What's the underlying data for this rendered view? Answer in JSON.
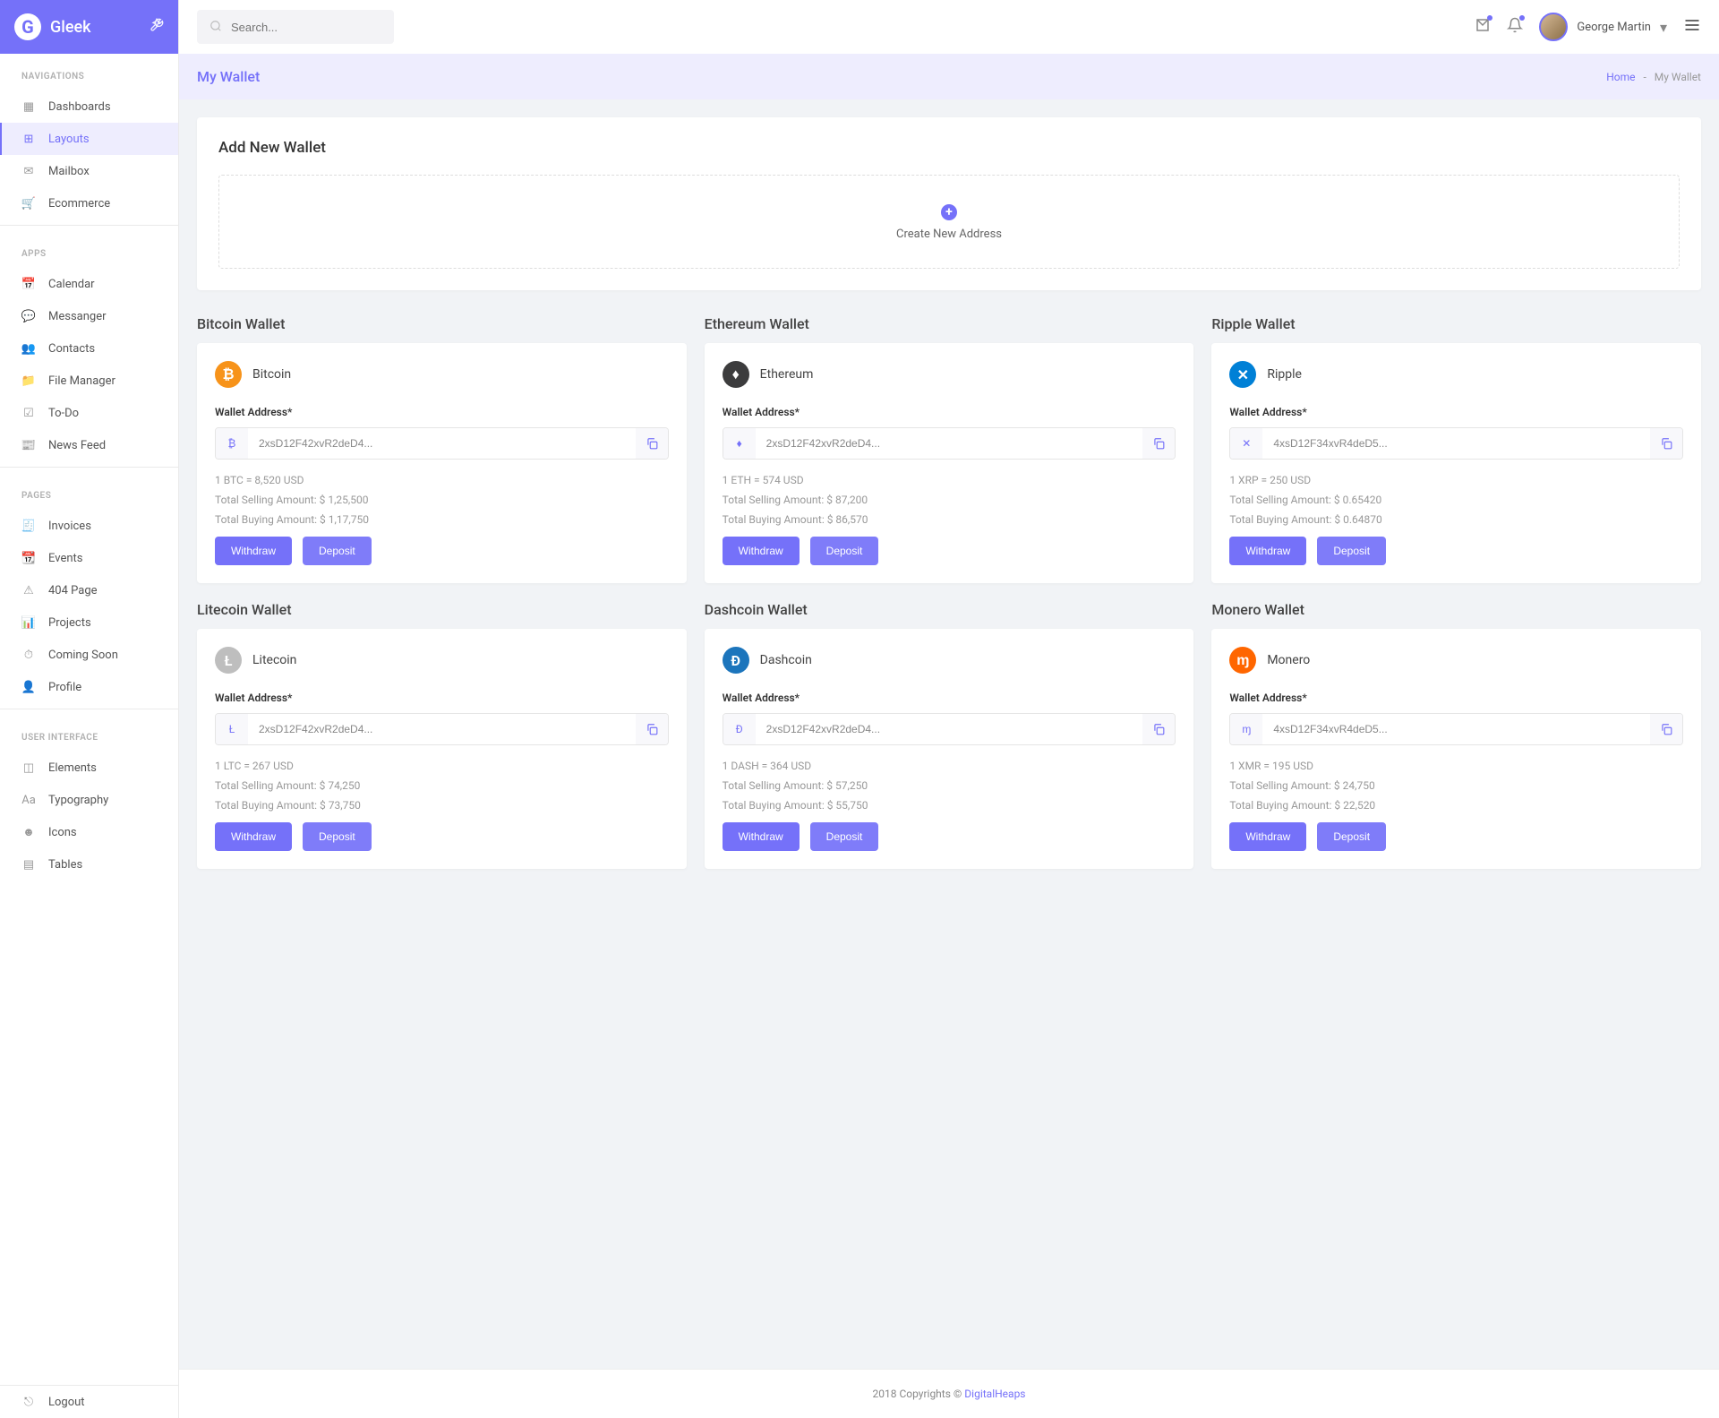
{
  "brand": "Gleek",
  "search": {
    "placeholder": "Search..."
  },
  "user": {
    "name": "George Martin"
  },
  "pageHeader": {
    "title": "My Wallet",
    "breadcrumb_home": "Home",
    "breadcrumb_sep": "-",
    "breadcrumb_current": "My Wallet"
  },
  "sidebar": {
    "sections": {
      "navigations": {
        "title": "NAVIGATIONS",
        "items": [
          "Dashboards",
          "Layouts",
          "Mailbox",
          "Ecommerce"
        ]
      },
      "apps": {
        "title": "APPS",
        "items": [
          "Calendar",
          "Messanger",
          "Contacts",
          "File Manager",
          "To-Do",
          "News Feed"
        ]
      },
      "pages": {
        "title": "PAGES",
        "items": [
          "Invoices",
          "Events",
          "404 Page",
          "Projects",
          "Coming Soon",
          "Profile"
        ]
      },
      "ui": {
        "title": "USER INTERFACE",
        "items": [
          "Elements",
          "Typography",
          "Icons",
          "Tables"
        ]
      }
    },
    "logout": "Logout"
  },
  "addWallet": {
    "title": "Add New Wallet",
    "createLabel": "Create New Address"
  },
  "labels": {
    "walletAddress": "Wallet Address*",
    "withdraw": "Withdraw",
    "deposit": "Deposit"
  },
  "wallets": [
    {
      "heading": "Bitcoin Wallet",
      "name": "Bitcoin",
      "symbol": "₿",
      "iconBg": "#f7931a",
      "address": "2xsD12F42xvR2deD4...",
      "rate": "1 BTC = 8,520 USD",
      "selling": "Total Selling Amount: $ 1,25,500",
      "buying": "Total Buying Amount: $ 1,17,750"
    },
    {
      "heading": "Ethereum Wallet",
      "name": "Ethereum",
      "symbol": "♦",
      "iconBg": "#3c3c3d",
      "address": "2xsD12F42xvR2deD4...",
      "rate": "1 ETH = 574 USD",
      "selling": "Total Selling Amount: $ 87,200",
      "buying": "Total Buying Amount: $ 86,570"
    },
    {
      "heading": "Ripple Wallet",
      "name": "Ripple",
      "symbol": "✕",
      "iconBg": "#0080d6",
      "address": "4xsD12F34xvR4deD5...",
      "rate": "1 XRP = 250 USD",
      "selling": "Total Selling Amount: $ 0.65420",
      "buying": "Total Buying Amount: $ 0.64870"
    },
    {
      "heading": "Litecoin Wallet",
      "name": "Litecoin",
      "symbol": "Ł",
      "iconBg": "#bebebe",
      "address": "2xsD12F42xvR2deD4...",
      "rate": "1 LTC = 267 USD",
      "selling": "Total Selling Amount: $ 74,250",
      "buying": "Total Buying Amount: $ 73,750"
    },
    {
      "heading": "Dashcoin Wallet",
      "name": "Dashcoin",
      "symbol": "Đ",
      "iconBg": "#1c75bc",
      "address": "2xsD12F42xvR2deD4...",
      "rate": "1 DASH = 364 USD",
      "selling": "Total Selling Amount: $ 57,250",
      "buying": "Total Buying Amount: $ 55,750"
    },
    {
      "heading": "Monero Wallet",
      "name": "Monero",
      "symbol": "ɱ",
      "iconBg": "#ff6600",
      "address": "4xsD12F34xvR4deD5...",
      "rate": "1 XMR = 195 USD",
      "selling": "Total Selling Amount: $ 24,750",
      "buying": "Total Buying Amount: $ 22,520"
    }
  ],
  "footer": {
    "text": "2018 Copyrights © ",
    "link": "DigitalHeaps"
  }
}
